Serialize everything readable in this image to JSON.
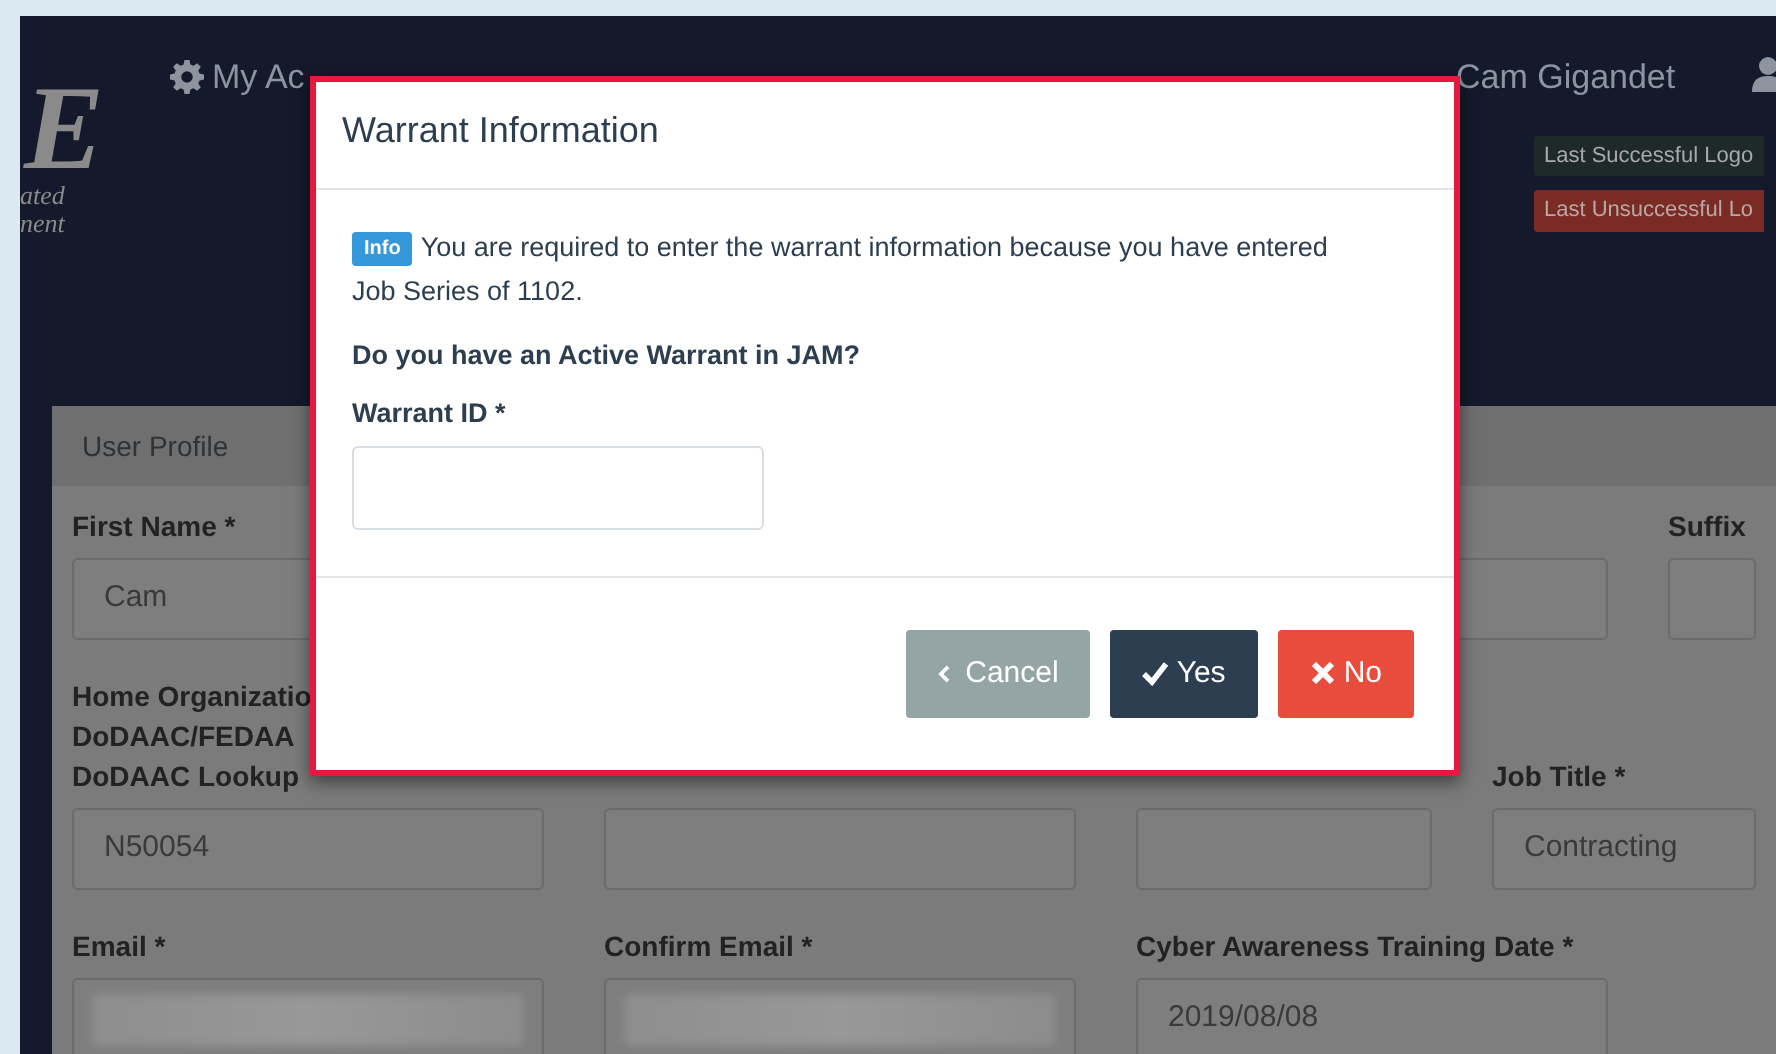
{
  "header": {
    "logo": {
      "letter": "E",
      "tagline": [
        "ated",
        "nent"
      ]
    },
    "nav": [
      {
        "label": "My Ac"
      }
    ],
    "user": {
      "name": "Cam Gigandet"
    },
    "logon_badges": [
      {
        "kind": "success",
        "text": "Last Successful Logo"
      },
      {
        "kind": "failure",
        "text": "Last Unsuccessful Lo"
      }
    ]
  },
  "profile": {
    "title": "User Profile",
    "rows": [
      {
        "kind": "split",
        "fields": [
          {
            "label": [
              "First Name *"
            ],
            "kind": "text",
            "value": "Cam"
          },
          {
            "kind": "text"
          },
          {
            "label": [
              "Suffix"
            ],
            "kind": "text"
          }
        ]
      },
      {
        "kind": "mixed",
        "fields": [
          {
            "label": [
              "Home Organizatio",
              "DoDAAC/FEDAA",
              "DoDAAC Lookup"
            ],
            "kind": "text",
            "value": "N50054"
          },
          {
            "kind": "text"
          },
          {
            "kind": "select"
          },
          {
            "label": [
              "Job Title *"
            ],
            "kind": "text",
            "value": "Contracting"
          }
        ]
      },
      {
        "kind": "even",
        "fields": [
          {
            "label": [
              "Email *"
            ],
            "kind": "redacted"
          },
          {
            "label": [
              "Confirm Email *"
            ],
            "kind": "redacted"
          },
          {
            "label": [
              "Cyber Awareness Training Date *"
            ],
            "kind": "text",
            "value": "2019/08/08"
          }
        ]
      }
    ]
  },
  "modal": {
    "title": "Warrant Information",
    "badge": "Info",
    "message_lines": [
      "You are required to enter the warrant information because you have entered",
      "Job Series of 1102."
    ],
    "question": "Do you have an Active Warrant in JAM?",
    "field_label": "Warrant ID *",
    "buttons": [
      {
        "kind": "cancel",
        "label": "Cancel"
      },
      {
        "kind": "yes",
        "label": "Yes"
      },
      {
        "kind": "no",
        "label": "No"
      }
    ]
  }
}
